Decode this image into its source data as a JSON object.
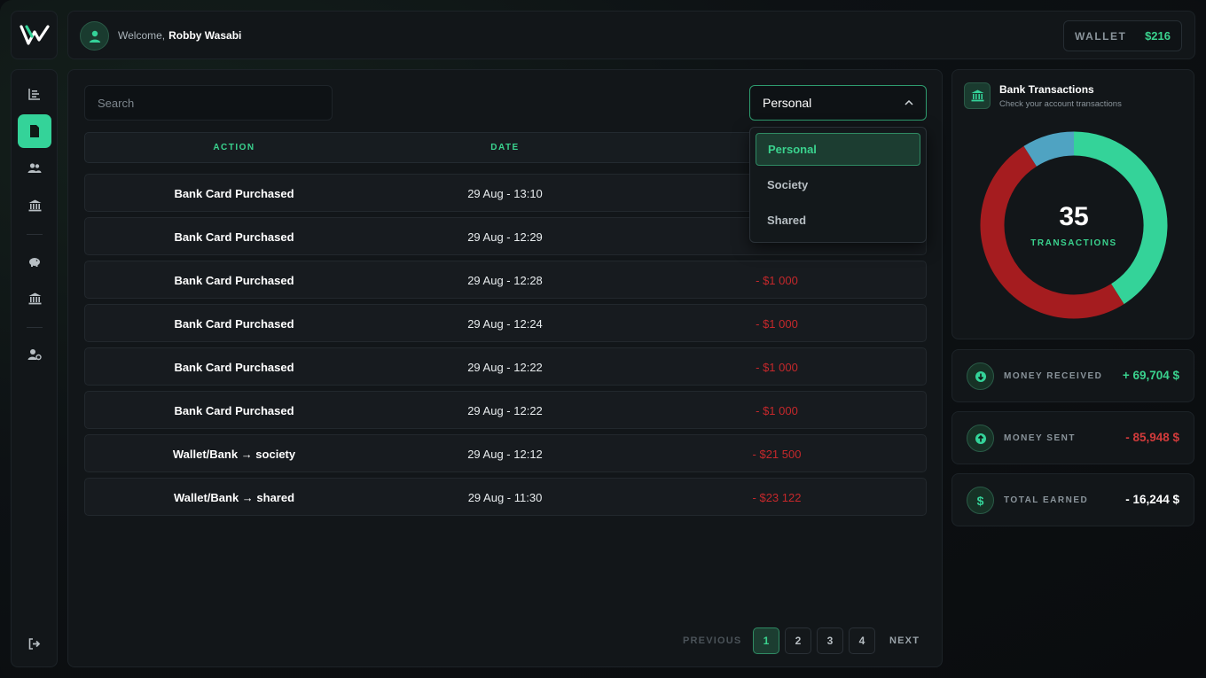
{
  "header": {
    "welcome_label": "Welcome,",
    "username": "Robby Wasabi",
    "wallet_label": "WALLET",
    "wallet_amount": "$216"
  },
  "sidebar": {
    "items": [
      {
        "icon": "chart-icon",
        "active": false
      },
      {
        "icon": "document-icon",
        "active": true
      },
      {
        "icon": "users-icon",
        "active": false
      },
      {
        "icon": "bank-icon",
        "active": false
      },
      {
        "icon": "piggy-bank-icon",
        "active": false
      },
      {
        "icon": "bank-icon",
        "active": false
      },
      {
        "icon": "user-settings-icon",
        "active": false
      }
    ],
    "logout_icon": "logout-icon"
  },
  "main": {
    "search_placeholder": "Search",
    "select_value": "Personal",
    "dropdown_options": [
      "Personal",
      "Society",
      "Shared"
    ],
    "columns": [
      "ACTION",
      "DATE"
    ],
    "rows": [
      {
        "action": "Bank Card Purchased",
        "date": "29 Aug - 13:10",
        "amount": ""
      },
      {
        "action": "Bank Card Purchased",
        "date": "29 Aug - 12:29",
        "amount": ""
      },
      {
        "action": "Bank Card Purchased",
        "date": "29 Aug - 12:28",
        "amount": "- $1 000"
      },
      {
        "action": "Bank Card Purchased",
        "date": "29 Aug - 12:24",
        "amount": "- $1 000"
      },
      {
        "action": "Bank Card Purchased",
        "date": "29 Aug - 12:22",
        "amount": "- $1 000"
      },
      {
        "action": "Bank Card Purchased",
        "date": "29 Aug - 12:22",
        "amount": "- $1 000"
      },
      {
        "action": "Wallet/Bank → society",
        "date": "29 Aug - 12:12",
        "amount": "- $21 500"
      },
      {
        "action": "Wallet/Bank → shared",
        "date": "29 Aug - 11:30",
        "amount": "- $23 122"
      }
    ],
    "pagination": {
      "previous": "PREVIOUS",
      "next": "NEXT",
      "pages": [
        "1",
        "2",
        "3",
        "4"
      ],
      "current": "1"
    }
  },
  "bank": {
    "title": "Bank Transactions",
    "subtitle": "Check your account transactions",
    "count": "35",
    "count_label": "TRANSACTIONS"
  },
  "chart_data": {
    "type": "pie",
    "categories": [
      "green",
      "red",
      "blue"
    ],
    "values": [
      41,
      50,
      9
    ],
    "colors": [
      "#34d399",
      "#a51c1f",
      "#4fa3c2"
    ]
  },
  "stats": [
    {
      "label": "MONEY RECEIVED",
      "value": "+ 69,704 $",
      "color": "#3ad28e",
      "icon": "arrow-down-icon"
    },
    {
      "label": "MONEY SENT",
      "value": "- 85,948 $",
      "color": "#d23b3b",
      "icon": "arrow-up-icon"
    },
    {
      "label": "TOTAL EARNED",
      "value": "- 16,244 $",
      "color": "#ffffff",
      "icon": "dollar-icon"
    }
  ]
}
